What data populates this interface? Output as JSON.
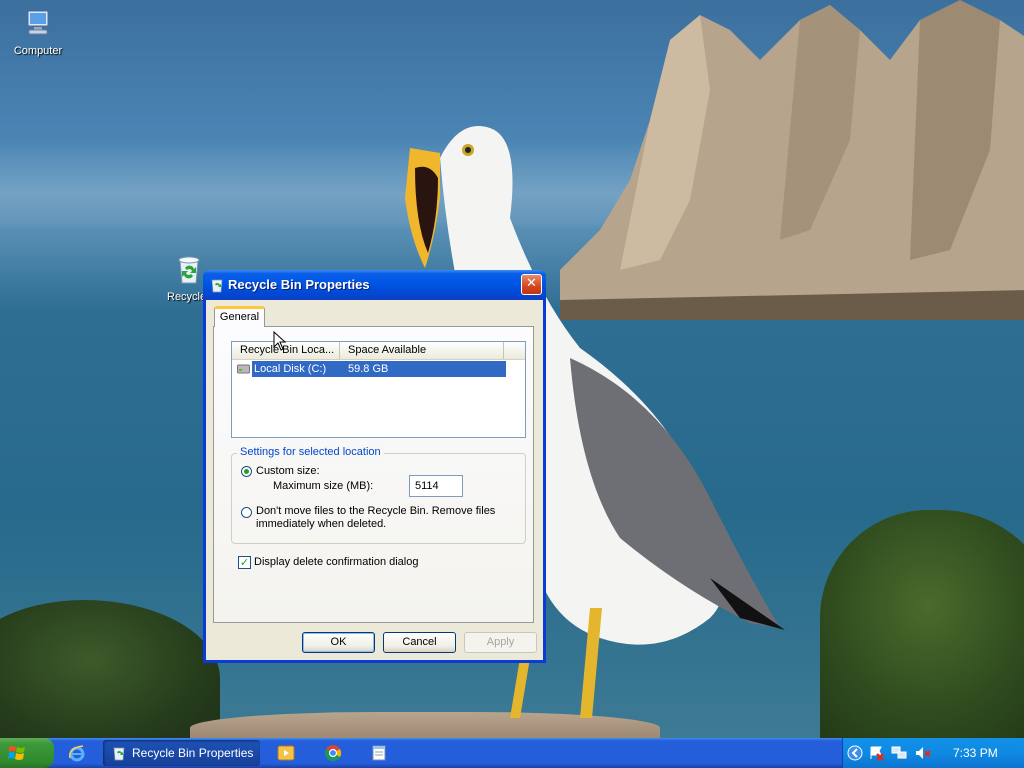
{
  "desktop": {
    "icons": [
      {
        "label": "Computer",
        "icon": "computer-icon"
      },
      {
        "label": "Recycle",
        "icon": "recycle-bin-icon"
      }
    ]
  },
  "dialog": {
    "title": "Recycle Bin Properties",
    "close_label": "✕",
    "tabs": [
      {
        "label": "General",
        "selected": true
      }
    ],
    "list": {
      "columns": [
        "Recycle Bin Loca...",
        "Space Available"
      ],
      "rows": [
        {
          "location": "Local Disk (C:)",
          "space": "59.8 GB",
          "selected": true,
          "icon": "drive-icon"
        }
      ]
    },
    "settings": {
      "group_label": "Settings for selected location",
      "custom_size_label": "Custom size:",
      "custom_size_selected": true,
      "max_size_label": "Maximum size (MB):",
      "max_size_value": "5114",
      "dont_move_label_line1": "Don't move files to the Recycle Bin. Remove files",
      "dont_move_label_line2": "immediately when deleted.",
      "dont_move_selected": false
    },
    "confirm_checkbox": {
      "label": "Display delete confirmation dialog",
      "checked": true
    },
    "buttons": {
      "ok": "OK",
      "cancel": "Cancel",
      "apply": "Apply",
      "apply_enabled": false
    }
  },
  "taskbar": {
    "quick_launch": [
      "internet-explorer-icon"
    ],
    "active_task": {
      "label": "Recycle Bin Properties",
      "icon": "recycle-bin-icon"
    },
    "pinned": [
      "media-player-icon",
      "chrome-icon",
      "notepad-icon"
    ],
    "tray_icons": [
      "expand-tray-icon",
      "security-alert-icon",
      "network-icon",
      "volume-muted-icon"
    ],
    "clock": "7:33 PM"
  },
  "colors": {
    "taskbar_blue": "#245edb",
    "start_green": "#3c993a",
    "title_blue": "#0055e5",
    "selection_blue": "#316ac5",
    "tab_highlight": "#ffc83c"
  }
}
